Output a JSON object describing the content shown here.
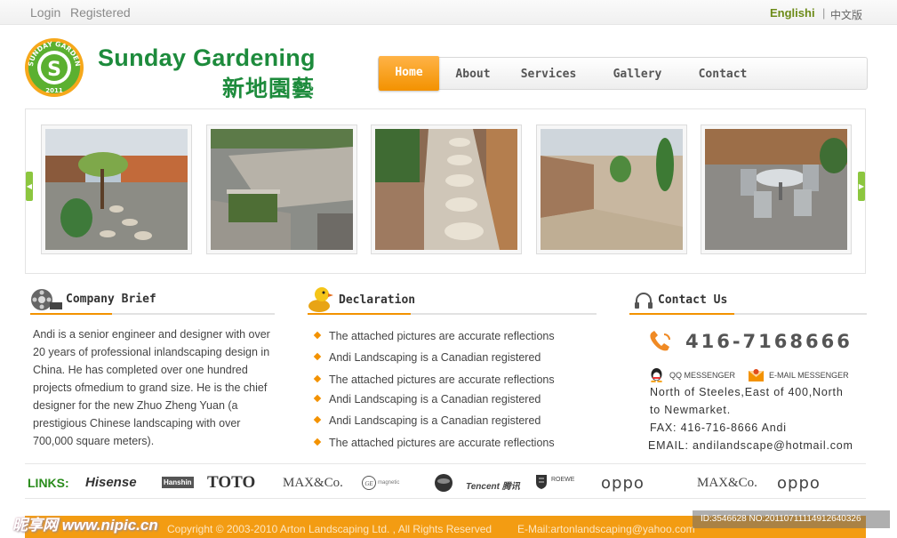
{
  "topbar": {
    "login": "Login",
    "registered": "Registered",
    "lang_en": "Englishi",
    "lang_sep": "|",
    "lang_cn": "中文版"
  },
  "header": {
    "logo_ring_text": "SUNDAY GARDEN",
    "logo_year": "2011",
    "brand_en": "Sunday Gardening",
    "brand_cn": "新地園藝"
  },
  "nav": {
    "items": [
      {
        "label": "Home",
        "active": true
      },
      {
        "label": "About",
        "active": false
      },
      {
        "label": "Services",
        "active": false
      },
      {
        "label": "Gallery",
        "active": false
      },
      {
        "label": "Contact",
        "active": false
      }
    ]
  },
  "gallery": {
    "prev_icon": "chevron-left-icon",
    "next_icon": "chevron-right-icon",
    "photos": [
      "garden-path-fence",
      "patio-steps-planter",
      "stone-stepping-path",
      "curved-retaining-wall",
      "patio-table-chairs"
    ]
  },
  "company": {
    "title": "Company Brief",
    "icon": "film-reel-icon",
    "text": "Andi is a senior engineer and designer with over 20 years of professional inlandscaping design in China. He has completed over one hundred projects ofmedium to grand size. He is the chief designer for the new Zhuo Zheng Yuan (a prestigious Chinese landscaping with over 700,000 square meters)."
  },
  "declaration": {
    "title": "Declaration",
    "icon": "duck-icon",
    "items": [
      "The attached pictures are accurate reflections",
      "Andi Landscaping is a Canadian registered",
      "The attached pictures are accurate reflections",
      "Andi Landscaping is a Canadian registered",
      "Andi Landscaping is a Canadian registered",
      "The attached pictures are accurate reflections"
    ]
  },
  "contact": {
    "title": "Contact Us",
    "icon": "headset-icon",
    "phone": "416-7168666",
    "qq": "QQ MESSENGER",
    "email_messenger": "E-MAIL MESSENGER",
    "address_line1": "North of Steeles,East of 400,North",
    "address_line2": "to Newmarket.",
    "fax": "FAX: 416-716-8666 Andi",
    "email": "EMAIL: andilandscape@hotmail.com"
  },
  "links": {
    "label": "LINKS:",
    "partners": [
      "Hisense",
      "Hanshin",
      "TOTO",
      "MAX&Co.",
      "magnetic",
      "",
      "Tencent 腾讯",
      "ROEWE",
      "oppo",
      "MAX&Co.",
      "oppo"
    ]
  },
  "footer": {
    "copyright": "Copyright © 2003-2010 Arton Landscaping Ltd. , All Rights Reserved",
    "email": "E-Mail:artonlandscaping@yahoo.com"
  },
  "watermark": {
    "site": "昵享网 www.nipic.cn",
    "id": "ID:3546628 NO:20110711114912640326"
  },
  "colors": {
    "orange": "#f39200",
    "green": "#1d8b3c",
    "link_green": "#2a8c1c"
  }
}
